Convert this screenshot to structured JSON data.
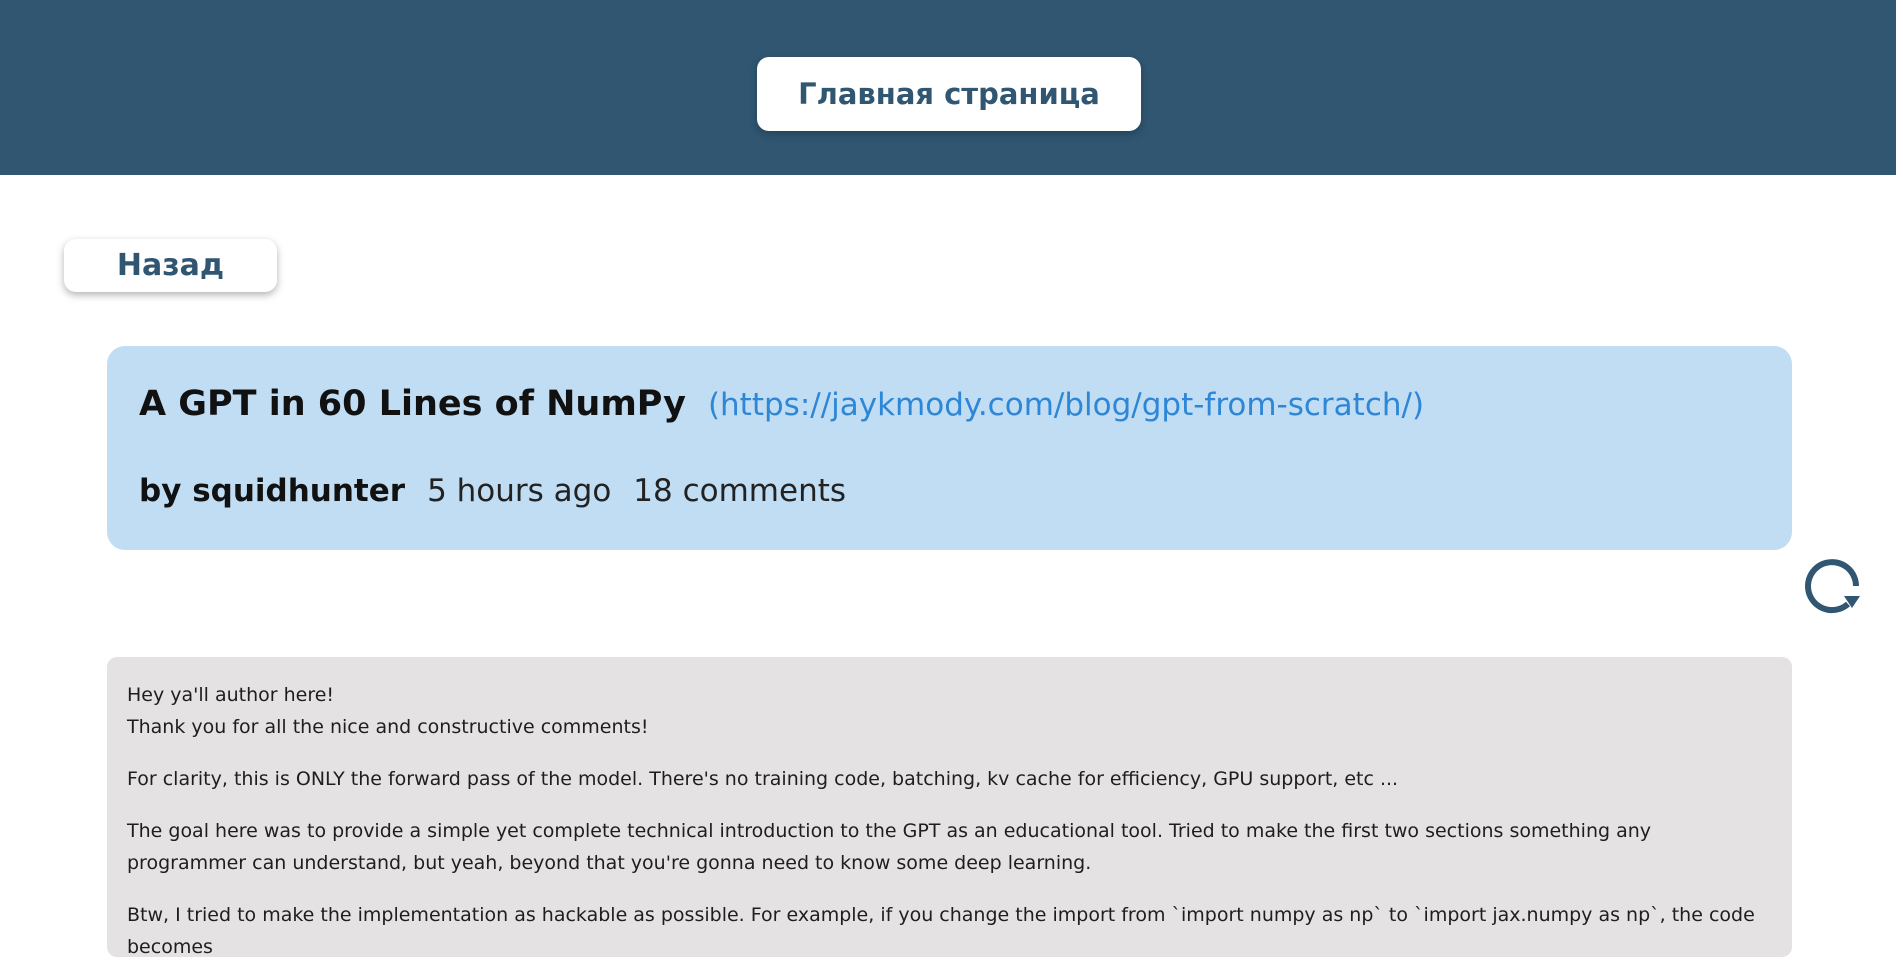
{
  "header": {
    "home_label": "Главная страница"
  },
  "nav": {
    "back_label": "Назад"
  },
  "story": {
    "title": "A GPT in 60 Lines of NumPy",
    "url_text": "(https://jaykmody.com/blog/gpt-from-scratch/)",
    "author": "by squidhunter",
    "time_ago": "5 hours ago",
    "comments": "18 comments"
  },
  "refresh": {
    "icon": "refresh-icon"
  },
  "comment": {
    "line1": "Hey ya'll author here!",
    "line2": "Thank you for all the nice and constructive comments!",
    "para2": "For clarity, this is ONLY the forward pass of the model. There's no training code, batching, kv cache for efficiency, GPU support, etc ...",
    "para3": "The goal here was to provide a simple yet complete technical introduction to the GPT as an educational tool. Tried to make the first two sections something any programmer can understand, but yeah, beyond that you're gonna need to know some deep learning.",
    "para4": "Btw, I tried to make the implementation as hackable as possible. For example, if you change the import from `import numpy as np` to `import jax.numpy as np`, the code becomes"
  },
  "colors": {
    "header_bg": "#305672",
    "card_bg": "#c0ddf3",
    "link": "#2e86d6",
    "comment_bg": "#e4e2e3"
  }
}
